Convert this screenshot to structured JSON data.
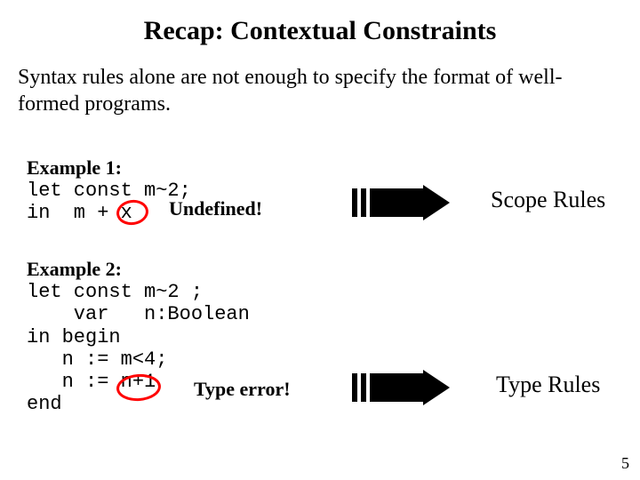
{
  "title": "Recap:  Contextual Constraints",
  "intro": "Syntax rules alone are not enough to specify the format of well-formed programs.",
  "example1": {
    "header": "Example 1:",
    "line1": "let const m~2;",
    "line2": "in  m + x",
    "errlabel": "Undefined!",
    "rulelabel": "Scope Rules"
  },
  "example2": {
    "header": "Example 2:",
    "line1": "let const m~2 ;",
    "line2": "    var   n:Boolean",
    "line3": "in begin",
    "line4": "   n := m<4;",
    "line5": "   n := n+1",
    "line6": "end",
    "errlabel": "Type error!",
    "rulelabel": "Type Rules"
  },
  "pagenum": "5",
  "colors": {
    "circle": "#ff0000"
  }
}
